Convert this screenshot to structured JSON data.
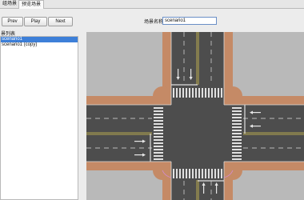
{
  "tabs": [
    {
      "label": "组场景"
    },
    {
      "label": "预览场景",
      "active": true
    }
  ],
  "toolbar": {
    "prev_label": "Prev",
    "play_label": "Play",
    "next_label": "Next",
    "name_label": "场景名称",
    "name_value": "scenario1"
  },
  "scenario_list": {
    "title": "景列表",
    "items": [
      {
        "label": "scenario1",
        "selected": true
      },
      {
        "label": "scenario1 (copy)",
        "selected": false
      }
    ]
  },
  "map": {
    "colors": {
      "grass": "#b9b9b9",
      "sidewalk": "#c58a66",
      "road": "#4d4d4d",
      "marking": "#e6e6e6",
      "center_line": "#d9c451",
      "stop_line": "#e0e0e0"
    }
  }
}
